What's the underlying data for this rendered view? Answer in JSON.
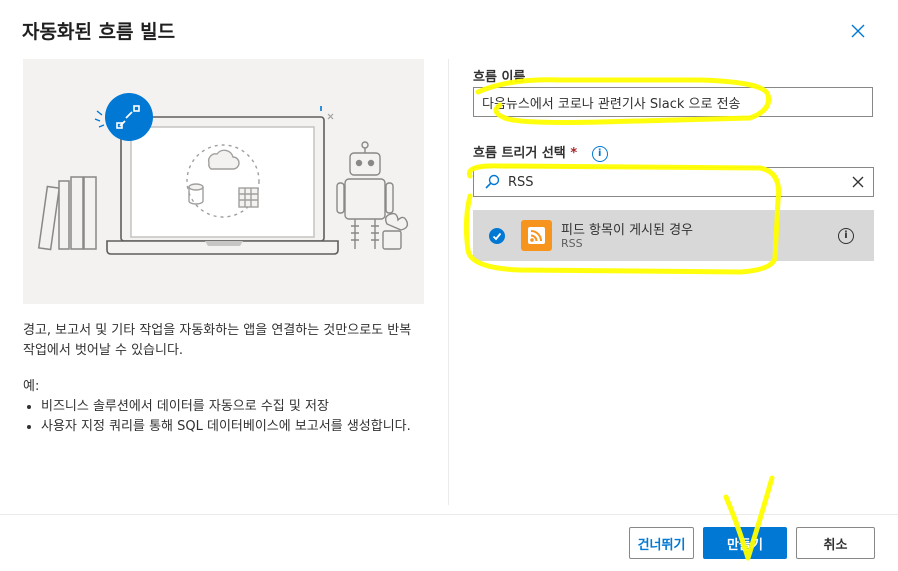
{
  "dialog": {
    "title": "자동화된 흐름 빌드",
    "close_icon": "close-icon"
  },
  "description": {
    "intro": "경고, 보고서 및 기타 작업을 자동화하는 앱을 연결하는 것만으로도 반복 작업에서 벗어날 수 있습니다.",
    "examples_label": "예:",
    "examples": [
      "비즈니스 솔루션에서 데이터를 자동으로 수집 및 저장",
      "사용자 지정 쿼리를 통해 SQL 데이터베이스에 보고서를 생성합니다."
    ]
  },
  "form": {
    "flow_name_label": "흐름 이름",
    "flow_name_value": "다음뉴스에서 코로나 관련기사 Slack 으로 전송",
    "trigger_label": "흐름 트리거 선택",
    "required_mark": "*",
    "search_value": "RSS",
    "trigger_option": {
      "title": "피드 항목이 게시된 경우",
      "connector": "RSS",
      "selected": true,
      "icon": "rss-icon"
    }
  },
  "buttons": {
    "skip": "건너뛰기",
    "create": "만들기",
    "cancel": "취소"
  },
  "colors": {
    "accent": "#0078d4",
    "rss": "#f7941d",
    "highlight_markup": "#ffff00",
    "selected_row": "#d8d8d8"
  }
}
